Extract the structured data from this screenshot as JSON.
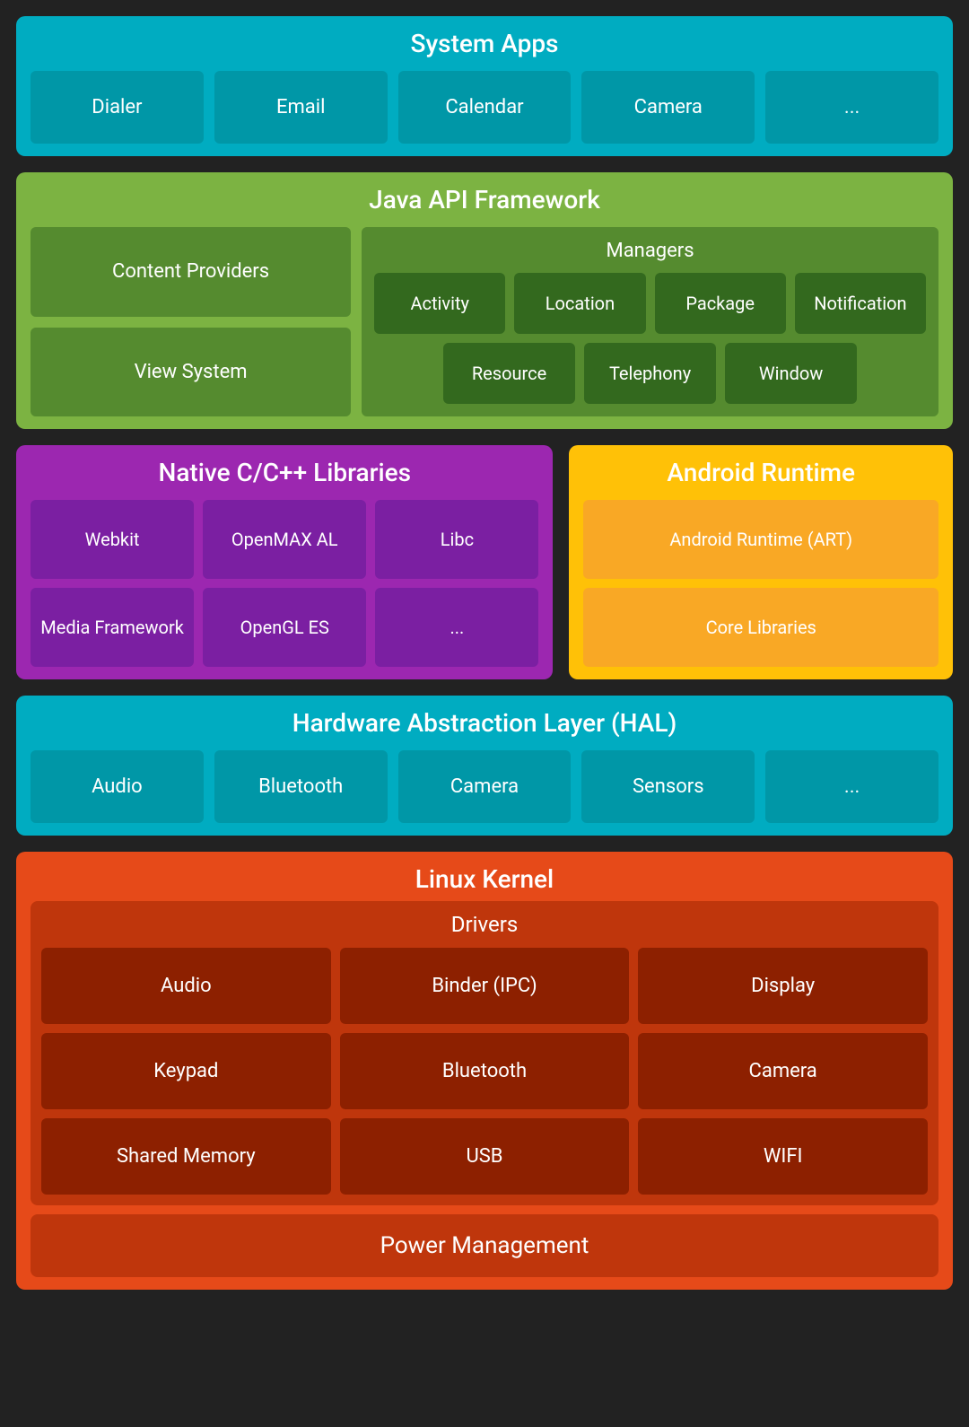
{
  "system_apps": {
    "title": "System Apps",
    "cells": [
      "Dialer",
      "Email",
      "Calendar",
      "Camera",
      "..."
    ]
  },
  "java_api": {
    "title": "Java API Framework",
    "left": [
      "Content Providers",
      "View System"
    ],
    "managers": {
      "title": "Managers",
      "row1": [
        "Activity",
        "Location",
        "Package",
        "Notification"
      ],
      "row2": [
        "Resource",
        "Telephony",
        "Window"
      ]
    }
  },
  "native_cpp": {
    "title": "Native C/C++ Libraries",
    "row1": [
      "Webkit",
      "OpenMAX AL",
      "Libc"
    ],
    "row2": [
      "Media Framework",
      "OpenGL ES",
      "..."
    ]
  },
  "android_runtime": {
    "title": "Android Runtime",
    "cells": [
      "Android Runtime (ART)",
      "Core Libraries"
    ]
  },
  "hal": {
    "title": "Hardware Abstraction Layer (HAL)",
    "cells": [
      "Audio",
      "Bluetooth",
      "Camera",
      "Sensors",
      "..."
    ]
  },
  "linux_kernel": {
    "title": "Linux Kernel",
    "drivers": {
      "title": "Drivers",
      "cells": [
        "Audio",
        "Binder (IPC)",
        "Display",
        "Keypad",
        "Bluetooth",
        "Camera",
        "Shared Memory",
        "USB",
        "WIFI"
      ]
    },
    "power_management": "Power Management"
  }
}
